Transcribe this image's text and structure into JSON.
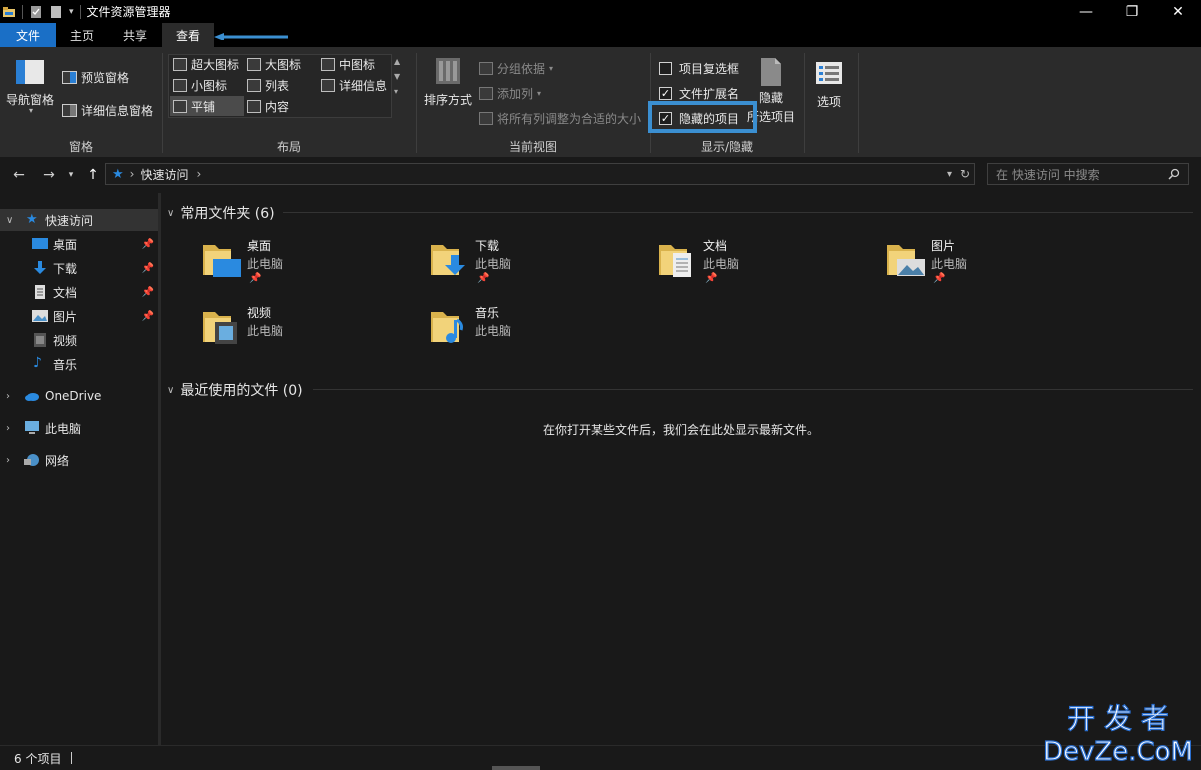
{
  "window": {
    "title": "文件资源管理器",
    "minimize_glyph": "—",
    "restore_glyph": "❐",
    "close_glyph": "✕"
  },
  "tabs": {
    "file": "文件",
    "home": "主页",
    "share": "共享",
    "view": "查看",
    "collapse_glyph": "⌃",
    "help_glyph": "?"
  },
  "ribbon": {
    "panes": {
      "nav_pane": "导航窗格",
      "preview_pane": "预览窗格",
      "details_pane": "详细信息窗格",
      "group_label": "窗格"
    },
    "layout": {
      "extra_large": "超大图标",
      "large": "大图标",
      "medium": "中图标",
      "small": "小图标",
      "list": "列表",
      "details": "详细信息",
      "tiles": "平铺",
      "content": "内容",
      "group_label": "布局"
    },
    "current_view": {
      "sort_by": "排序方式",
      "group_by": "分组依据",
      "add_columns": "添加列",
      "size_all_columns": "将所有列调整为合适的大小",
      "group_label": "当前视图"
    },
    "show_hide": {
      "item_checkboxes": "项目复选框",
      "file_extensions": "文件扩展名",
      "hidden_items": "隐藏的项目",
      "hide_selected_line1": "隐藏",
      "hide_selected_line2": "所选项目",
      "group_label": "显示/隐藏"
    },
    "options": "选项"
  },
  "address": {
    "path_item": "快速访问",
    "separator": "›",
    "search_placeholder": "在 快速访问 中搜索"
  },
  "nav_pane": {
    "quick_access": "快速访问",
    "items": [
      {
        "label": "桌面"
      },
      {
        "label": "下载"
      },
      {
        "label": "文档"
      },
      {
        "label": "图片"
      },
      {
        "label": "视频"
      },
      {
        "label": "音乐"
      }
    ],
    "onedrive": "OneDrive",
    "this_pc": "此电脑",
    "network": "网络"
  },
  "content": {
    "frequent_header": "常用文件夹 (6)",
    "recent_header": "最近使用的文件 (0)",
    "empty_message": "在你打开某些文件后，我们会在此处显示最新文件。",
    "folders": [
      {
        "name": "桌面",
        "location": "此电脑"
      },
      {
        "name": "下载",
        "location": "此电脑"
      },
      {
        "name": "文档",
        "location": "此电脑"
      },
      {
        "name": "图片",
        "location": "此电脑"
      },
      {
        "name": "视频",
        "location": "此电脑"
      },
      {
        "name": "音乐",
        "location": "此电脑"
      }
    ]
  },
  "status": {
    "item_count": "6 个项目"
  },
  "watermark": {
    "line1": "开 发 者",
    "line2": "DevZe.CoM"
  },
  "colors": {
    "accent": "#1a6fc6",
    "highlight": "#3b8fd1",
    "folder": "#e8c66b"
  },
  "icons": [
    "search-icon",
    "refresh-icon",
    "pin-icon",
    "star-icon",
    "folder-icon",
    "back-arrow-icon",
    "forward-arrow-icon",
    "up-arrow-icon",
    "chevron-down-icon"
  ]
}
